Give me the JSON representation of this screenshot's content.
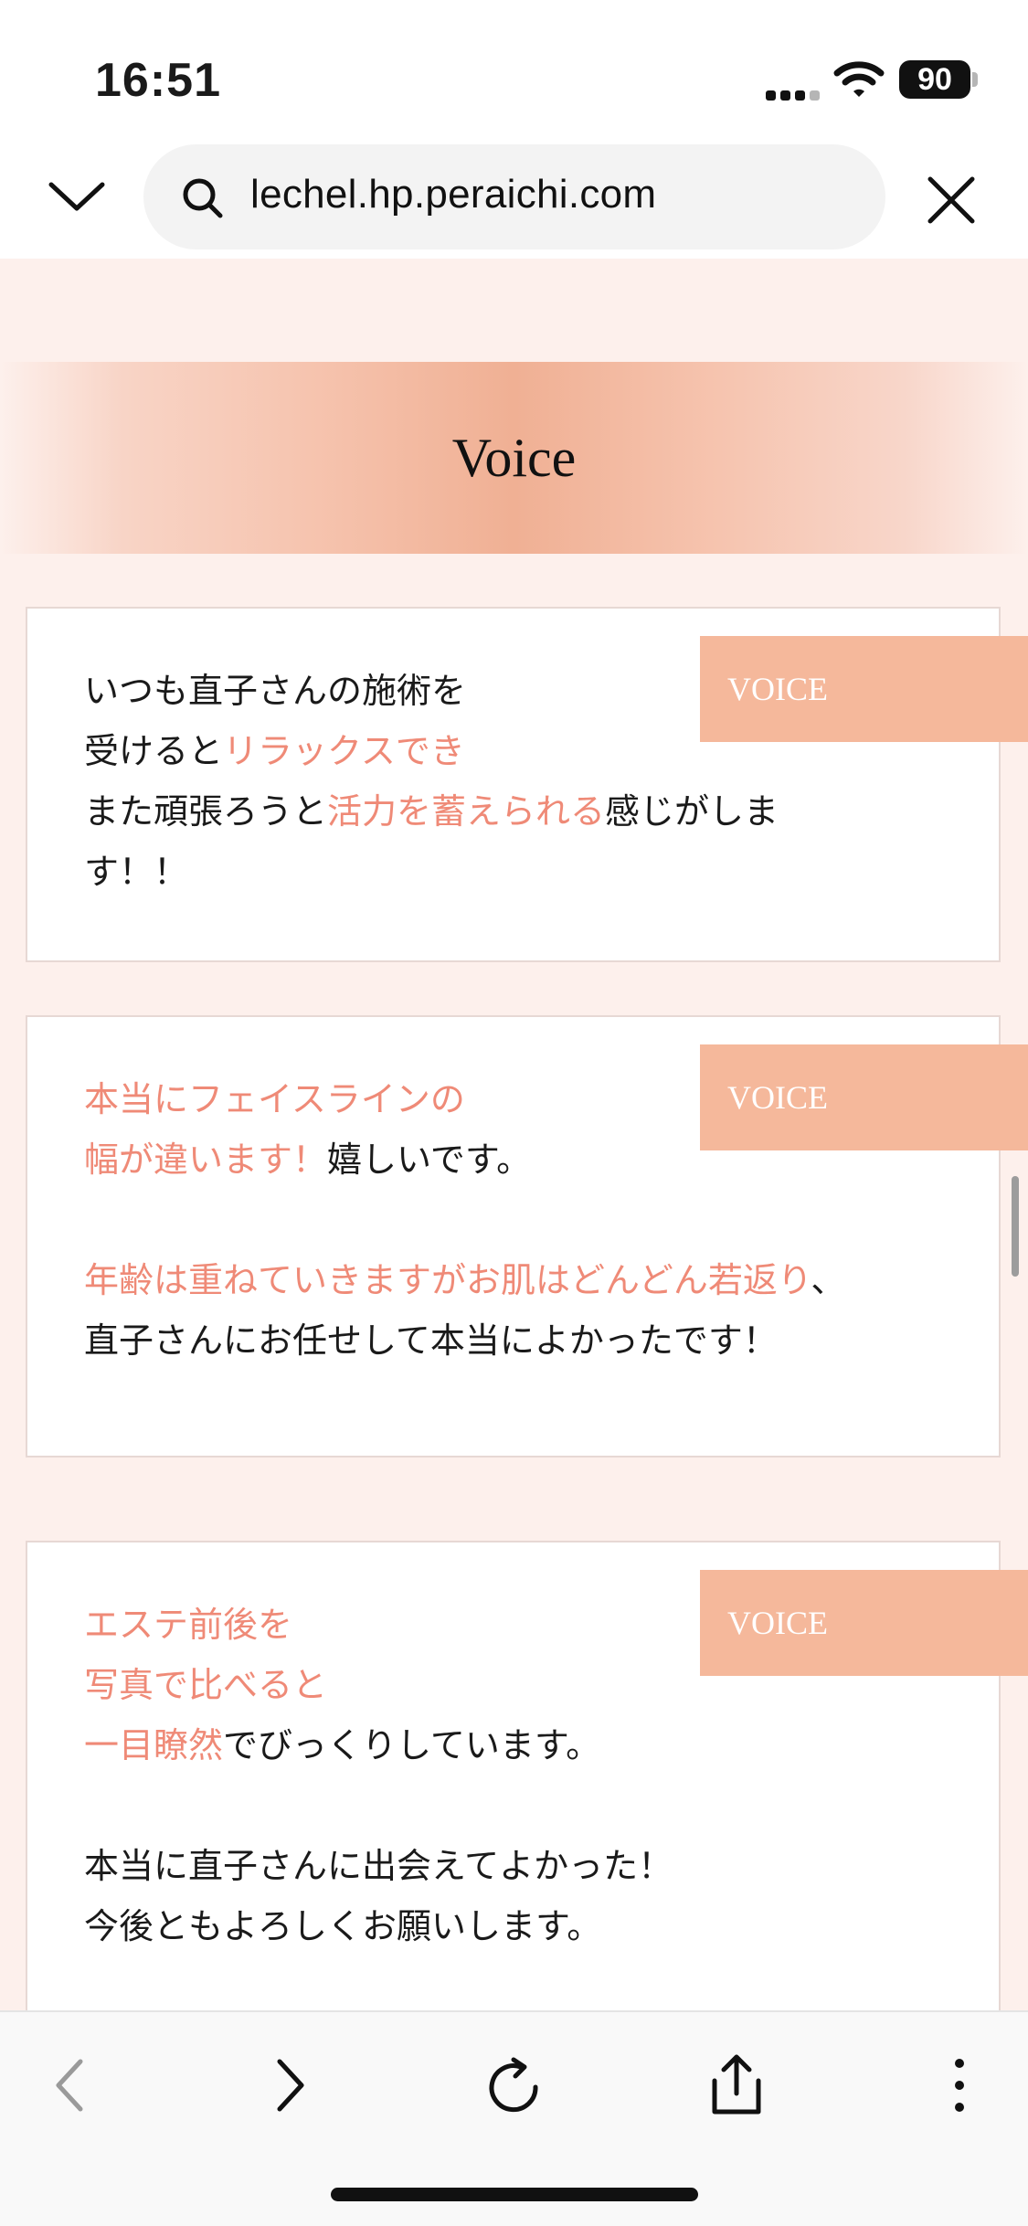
{
  "status_bar": {
    "time": "16:51",
    "battery": "90",
    "icons": [
      "signal-icon",
      "wifi-icon",
      "battery-icon"
    ]
  },
  "browser": {
    "url": "lechel.hp.peraichi.com",
    "icons": [
      "chevron-down-icon",
      "search-icon",
      "close-icon"
    ]
  },
  "section": {
    "title": "Voice"
  },
  "cards": [
    {
      "tag": "VOICE",
      "lines": [
        [
          {
            "t": "いつも直子さんの施術を",
            "h": false
          }
        ],
        [
          {
            "t": "受けると",
            "h": false
          },
          {
            "t": "リラックスでき",
            "h": true
          }
        ],
        [
          {
            "t": "また頑張ろうと",
            "h": false
          },
          {
            "t": "活力を蓄えられる",
            "h": true
          },
          {
            "t": "感じがしま",
            "h": false
          }
        ],
        [
          {
            "t": "す！！",
            "h": false
          }
        ]
      ]
    },
    {
      "tag": "VOICE",
      "lines": [
        [
          {
            "t": "本当にフェイスラインの",
            "h": true
          }
        ],
        [
          {
            "t": "幅が違います！",
            "h": true
          },
          {
            "t": "嬉しいです。",
            "h": false
          }
        ],
        [],
        [
          {
            "t": "年齢は重ねていきますがお肌はどんどん若返り",
            "h": true
          },
          {
            "t": "、",
            "h": false
          }
        ],
        [
          {
            "t": "直子さんにお任せして本当によかったです！",
            "h": false
          }
        ]
      ]
    },
    {
      "tag": "VOICE",
      "lines": [
        [
          {
            "t": "エステ前後を",
            "h": true
          }
        ],
        [
          {
            "t": "写真で比べると",
            "h": true
          }
        ],
        [
          {
            "t": "一目瞭然",
            "h": true
          },
          {
            "t": "でびっくりしています。",
            "h": false
          }
        ],
        [],
        [
          {
            "t": "本当に直子さんに出会えてよかった！",
            "h": false
          }
        ],
        [
          {
            "t": "今後ともよろしくお願いします。",
            "h": false
          }
        ]
      ]
    }
  ],
  "toolbar": {
    "buttons": [
      "back-icon",
      "forward-icon",
      "reload-icon",
      "share-icon",
      "more-icon"
    ]
  },
  "colors": {
    "accent": "#ef8a77",
    "tag_bg": "#f5b89b",
    "page_bg": "#fdf0ec"
  }
}
